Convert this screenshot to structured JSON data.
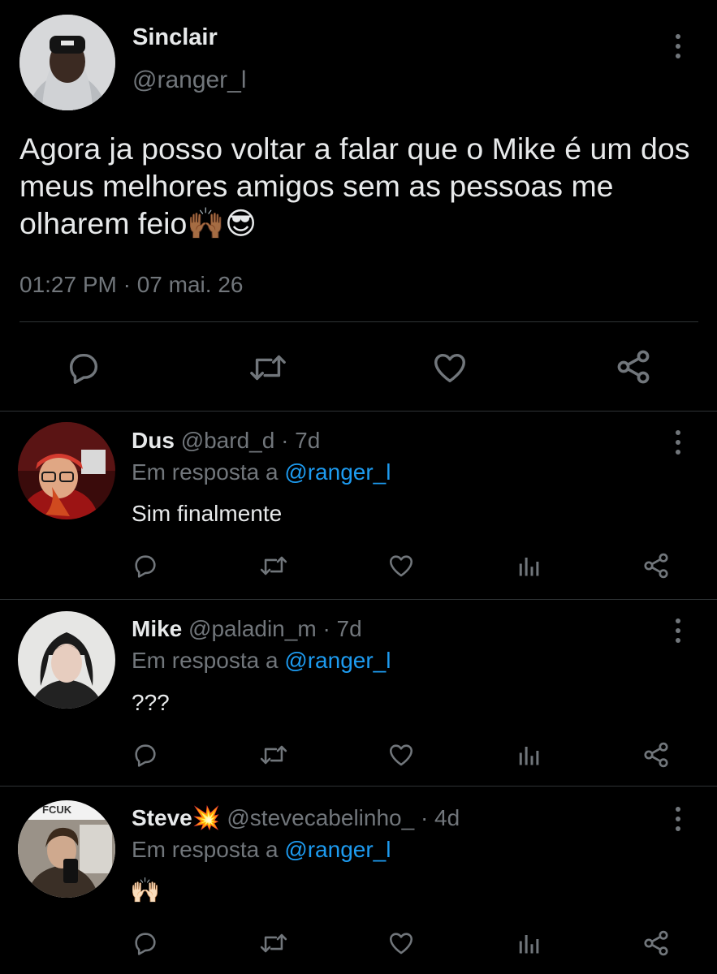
{
  "main_tweet": {
    "display_name": "Sinclair",
    "handle": "@ranger_l",
    "text": "Agora ja posso voltar a falar que o Mike é um dos meus melhores amigos sem as pessoas me olharem feio🙌🏾😎",
    "timestamp": "01:27 PM · 07 mai. 26",
    "actions": [
      "reply-icon",
      "retweet-icon",
      "like-icon",
      "share-icon"
    ]
  },
  "replies": [
    {
      "display_name": "Dus",
      "handle": "@bard_d",
      "age": "· 7d",
      "reply_to_prefix": "Em resposta a",
      "reply_to_handle": "@ranger_l",
      "text": "Sim finalmente"
    },
    {
      "display_name": "Mike",
      "handle": "@paladin_m",
      "age": "· 7d",
      "reply_to_prefix": "Em resposta a",
      "reply_to_handle": "@ranger_l",
      "text": "???"
    },
    {
      "display_name": "Steve💥",
      "handle": "@stevecabelinho_",
      "age": "· 4d",
      "reply_to_prefix": "Em resposta a",
      "reply_to_handle": "@ranger_l",
      "text": "🙌🏻",
      "avatar_caption": "FCUK"
    }
  ],
  "colors": {
    "background": "#000000",
    "text": "#e7e9ea",
    "muted": "#71767b",
    "link": "#1d9bf0",
    "divider": "#2f3336"
  }
}
